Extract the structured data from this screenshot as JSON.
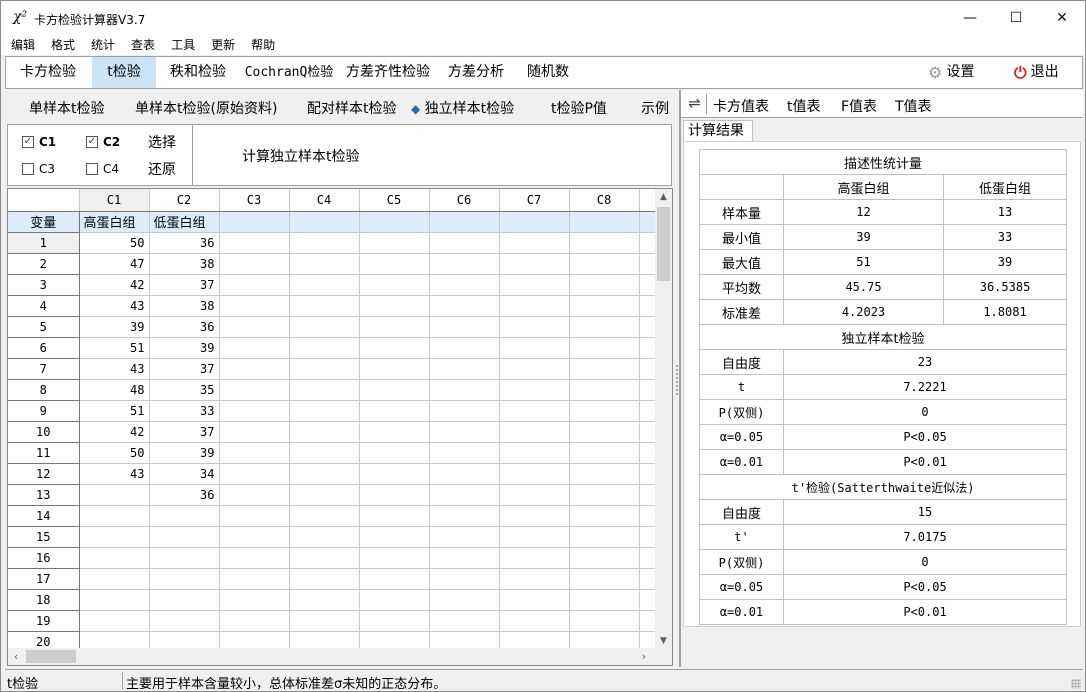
{
  "window": {
    "title": "卡方检验计算器V3.7",
    "app_icon": "χ²",
    "controls": {
      "minimize": "—",
      "maximize": "☐",
      "close": "✕"
    }
  },
  "menu": [
    "编辑",
    "格式",
    "统计",
    "查表",
    "工具",
    "更新",
    "帮助"
  ],
  "toolbar": {
    "tabs": [
      {
        "label": "卡方检验",
        "active": false
      },
      {
        "label": "t检验",
        "active": true
      },
      {
        "label": "秩和检验",
        "active": false
      },
      {
        "label": "CochranQ检验",
        "active": false
      },
      {
        "label": "方差齐性检验",
        "active": false
      },
      {
        "label": "方差分析",
        "active": false
      },
      {
        "label": "随机数",
        "active": false
      }
    ],
    "settings_label": "设置",
    "settings_icon": "gear-icon",
    "exit_label": "退出",
    "exit_icon": "power-icon",
    "exit_color": "#e02020"
  },
  "subtabs": {
    "items": [
      "单样本t检验",
      "单样本t检验(原始资料)",
      "配对样本t检验",
      "独立样本t检验",
      "t检验P值",
      "示例"
    ],
    "active_index": 3,
    "active_marker": "◆",
    "marker_color": "#2a6ab0"
  },
  "options": {
    "checkboxes": [
      {
        "label": "C1",
        "checked": true
      },
      {
        "label": "C2",
        "checked": true
      },
      {
        "label": "C3",
        "checked": false
      },
      {
        "label": "C4",
        "checked": false
      }
    ],
    "select_label": "选择",
    "restore_label": "还原",
    "action_label": "计算独立样本t检验"
  },
  "grid": {
    "columns": [
      "C1",
      "C2",
      "C3",
      "C4",
      "C5",
      "C6",
      "C7",
      "C8"
    ],
    "var_row_label": "变量",
    "var_names": [
      "高蛋白组",
      "低蛋白组",
      "",
      "",
      "",
      "",
      "",
      ""
    ],
    "rows": [
      {
        "n": "1",
        "c1": "50",
        "c2": "36"
      },
      {
        "n": "2",
        "c1": "47",
        "c2": "38"
      },
      {
        "n": "3",
        "c1": "42",
        "c2": "37"
      },
      {
        "n": "4",
        "c1": "43",
        "c2": "38"
      },
      {
        "n": "5",
        "c1": "39",
        "c2": "36"
      },
      {
        "n": "6",
        "c1": "51",
        "c2": "39"
      },
      {
        "n": "7",
        "c1": "43",
        "c2": "37"
      },
      {
        "n": "8",
        "c1": "48",
        "c2": "35"
      },
      {
        "n": "9",
        "c1": "51",
        "c2": "33"
      },
      {
        "n": "10",
        "c1": "42",
        "c2": "37"
      },
      {
        "n": "11",
        "c1": "50",
        "c2": "39"
      },
      {
        "n": "12",
        "c1": "43",
        "c2": "34"
      },
      {
        "n": "13",
        "c1": "",
        "c2": "36"
      },
      {
        "n": "14",
        "c1": "",
        "c2": ""
      },
      {
        "n": "15",
        "c1": "",
        "c2": ""
      },
      {
        "n": "16",
        "c1": "",
        "c2": ""
      },
      {
        "n": "17",
        "c1": "",
        "c2": ""
      },
      {
        "n": "18",
        "c1": "",
        "c2": ""
      },
      {
        "n": "19",
        "c1": "",
        "c2": ""
      },
      {
        "n": "20",
        "c1": "",
        "c2": ""
      }
    ]
  },
  "right": {
    "swap_icon": "⇌",
    "tabs": [
      "卡方值表",
      "t值表",
      "F值表",
      "T值表"
    ],
    "result_tab": "计算结果",
    "descriptive": {
      "title": "描述性统计量",
      "groups": [
        "高蛋白组",
        "低蛋白组"
      ],
      "rows": [
        {
          "label": "样本量",
          "g1": "12",
          "g2": "13"
        },
        {
          "label": "最小值",
          "g1": "39",
          "g2": "33"
        },
        {
          "label": "最大值",
          "g1": "51",
          "g2": "39"
        },
        {
          "label": "平均数",
          "g1": "45.75",
          "g2": "36.5385"
        },
        {
          "label": "标准差",
          "g1": "4.2023",
          "g2": "1.8081"
        }
      ]
    },
    "ttest": {
      "title": "独立样本t检验",
      "rows": [
        {
          "label": "自由度",
          "value": "23"
        },
        {
          "label": "t",
          "value": "7.2221"
        },
        {
          "label": "P(双侧)",
          "value": "0"
        },
        {
          "label": "α=0.05",
          "value": "P<0.05"
        },
        {
          "label": "α=0.01",
          "value": "P<0.01"
        }
      ]
    },
    "tprime": {
      "title": "t'检验(Satterthwaite近似法)",
      "rows": [
        {
          "label": "自由度",
          "value": "15"
        },
        {
          "label": "t'",
          "value": "7.0175"
        },
        {
          "label": "P(双侧)",
          "value": "0"
        },
        {
          "label": "α=0.05",
          "value": "P<0.05"
        },
        {
          "label": "α=0.01",
          "value": "P<0.01"
        }
      ]
    }
  },
  "status": {
    "left": "t检验",
    "message": "主要用于样本含量较小，总体标准差σ未知的正态分布。"
  }
}
